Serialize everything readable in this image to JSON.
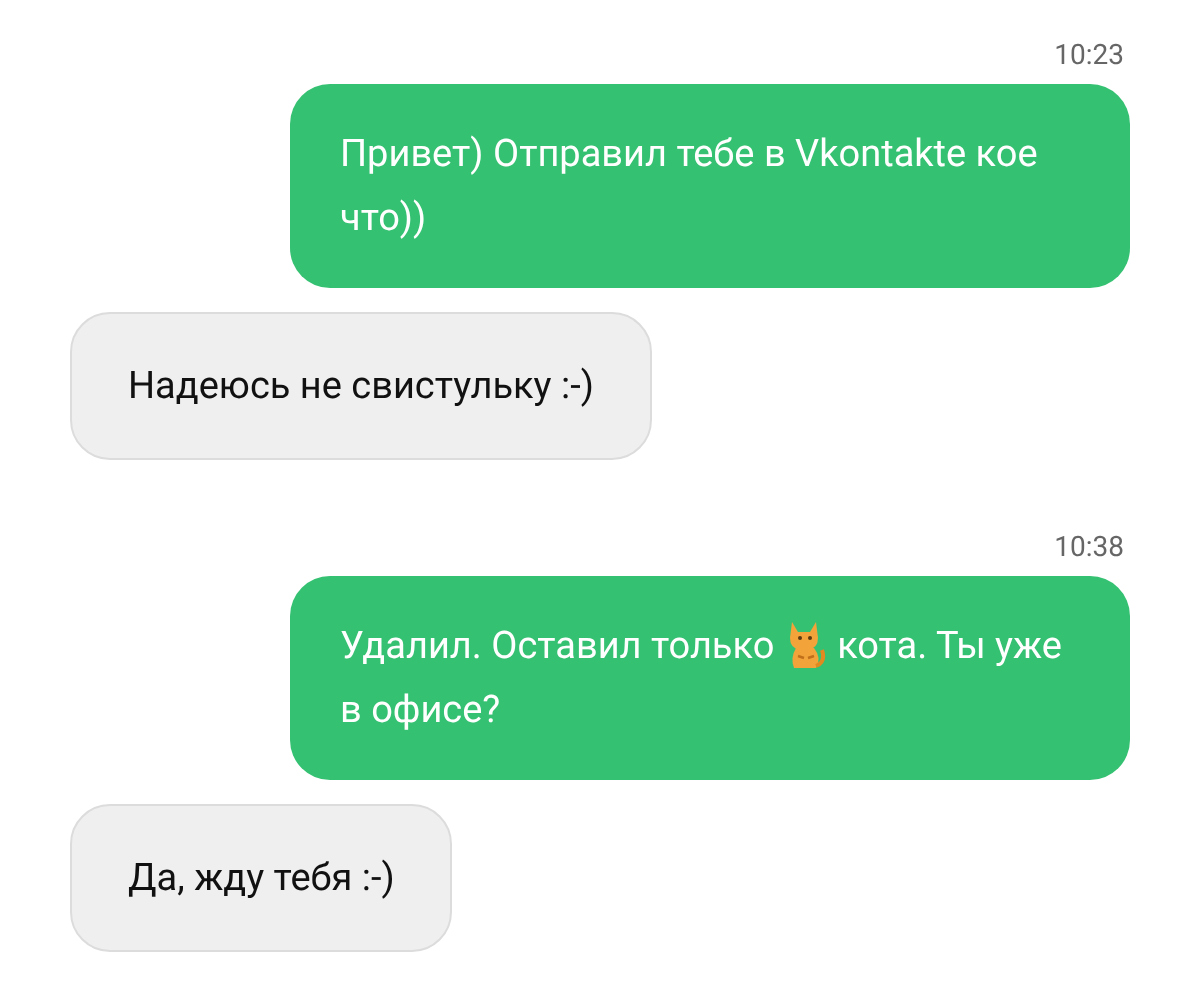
{
  "messages": [
    {
      "kind": "time",
      "text": "10:23"
    },
    {
      "kind": "outgoing",
      "parts": [
        {
          "kind": "text",
          "text": "Привет) Отправил тебе в Vkontakte кое что))"
        }
      ]
    },
    {
      "kind": "incoming",
      "parts": [
        {
          "kind": "text",
          "text": "Надеюсь не свистульку :-)"
        }
      ]
    },
    {
      "kind": "time",
      "text": "10:38"
    },
    {
      "kind": "outgoing",
      "parts": [
        {
          "kind": "text",
          "text": "Удалил. Оставил только "
        },
        {
          "kind": "emoji"
        },
        {
          "kind": "text",
          "text": " кота. Ты уже в офисе?"
        }
      ]
    },
    {
      "kind": "incoming",
      "parts": [
        {
          "kind": "text",
          "text": "Да, жду тебя :-)"
        }
      ]
    }
  ]
}
